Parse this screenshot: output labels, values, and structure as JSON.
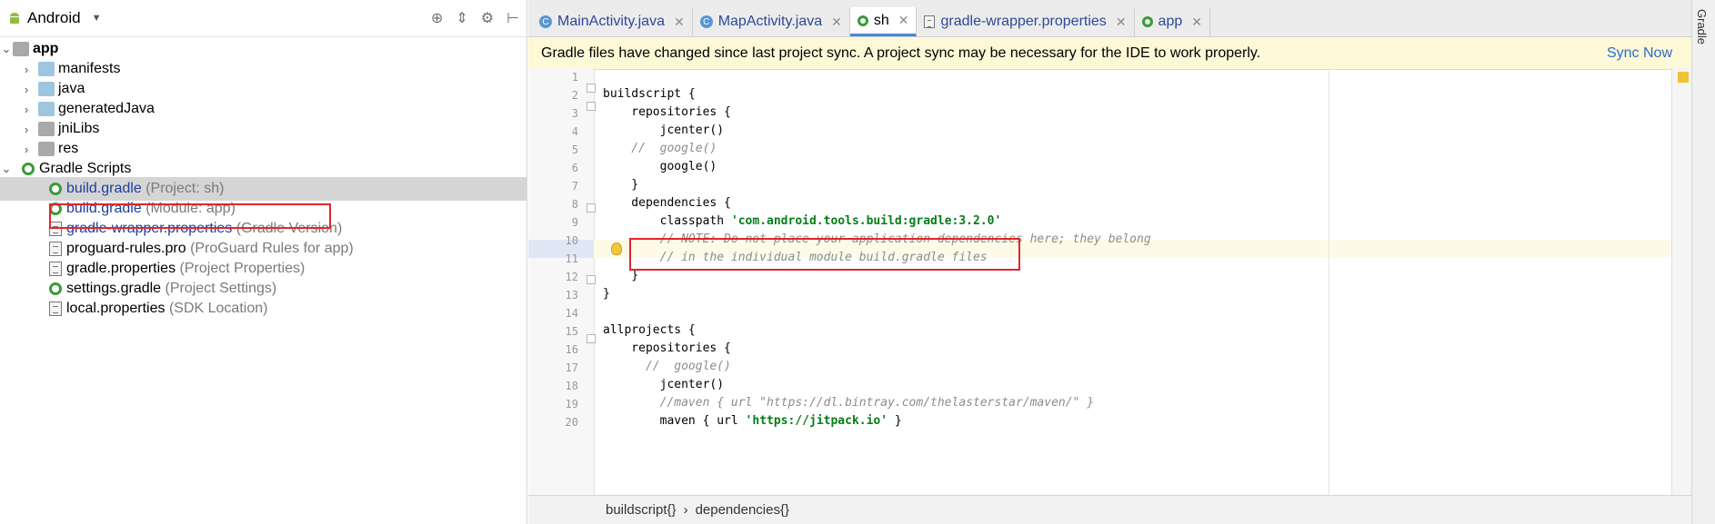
{
  "sidebar": {
    "title": "Android",
    "items": [
      {
        "label": "app",
        "hint": "",
        "icon": "module-folder-icon"
      },
      {
        "label": "manifests",
        "hint": "",
        "icon": "folder-icon"
      },
      {
        "label": "java",
        "hint": "",
        "icon": "folder-icon"
      },
      {
        "label": "generatedJava",
        "hint": "",
        "icon": "folder-icon"
      },
      {
        "label": "jniLibs",
        "hint": "",
        "icon": "folder-icon"
      },
      {
        "label": "res",
        "hint": "",
        "icon": "folder-icon"
      },
      {
        "label": "Gradle Scripts",
        "hint": "",
        "icon": "gradle-icon"
      },
      {
        "label": "build.gradle",
        "hint": "(Project: sh)",
        "icon": "gradle-icon"
      },
      {
        "label": "build.gradle",
        "hint": "(Module: app)",
        "icon": "gradle-icon"
      },
      {
        "label": "gradle-wrapper.properties",
        "hint": "(Gradle Version)",
        "icon": "properties-icon"
      },
      {
        "label": "proguard-rules.pro",
        "hint": "(ProGuard Rules for app)",
        "icon": "properties-icon"
      },
      {
        "label": "gradle.properties",
        "hint": "(Project Properties)",
        "icon": "properties-icon"
      },
      {
        "label": "settings.gradle",
        "hint": "(Project Settings)",
        "icon": "gradle-icon"
      },
      {
        "label": "local.properties",
        "hint": "(SDK Location)",
        "icon": "properties-icon"
      }
    ]
  },
  "tabs": [
    {
      "label": "MainActivity.java",
      "icon": "java-class-icon"
    },
    {
      "label": "MapActivity.java",
      "icon": "java-class-icon"
    },
    {
      "label": "sh",
      "icon": "gradle-icon"
    },
    {
      "label": "gradle-wrapper.properties",
      "icon": "properties-icon"
    },
    {
      "label": "app",
      "icon": "gradle-icon"
    }
  ],
  "banner": {
    "message": "Gradle files have changed since last project sync. A project sync may be necessary for the IDE to work properly.",
    "action": "Sync Now"
  },
  "editor": {
    "line_numbers": [
      "1",
      "2",
      "3",
      "4",
      "5",
      "6",
      "7",
      "8",
      "9",
      "10",
      "11",
      "12",
      "13",
      "14",
      "15",
      "16",
      "17",
      "18",
      "19",
      "20"
    ],
    "lines": [
      "",
      "buildscript {",
      "    repositories {",
      "        jcenter()",
      "    //  google()",
      "        google()",
      "    }",
      "    dependencies {",
      "        classpath ",
      "        // NOTE: Do not place your application dependencies here; they belong",
      "        // in the individual module build.gradle files",
      "    }",
      "}",
      "",
      "allprojects {",
      "    repositories {",
      "      //  google()",
      "        jcenter()",
      "        //maven { url \"https://dl.bintray.com/thelasterstar/maven/\" }",
      "        maven { url "
    ],
    "line9_string": "'com.android.tools.build:gradle:3.2.0'",
    "line20_string": "'https://jitpack.io'",
    "line20_tail": " }"
  },
  "breadcrumb": {
    "items": [
      "buildscript{}",
      "dependencies{}"
    ],
    "separator": "›"
  },
  "right_panel": {
    "label": "Gradle"
  }
}
